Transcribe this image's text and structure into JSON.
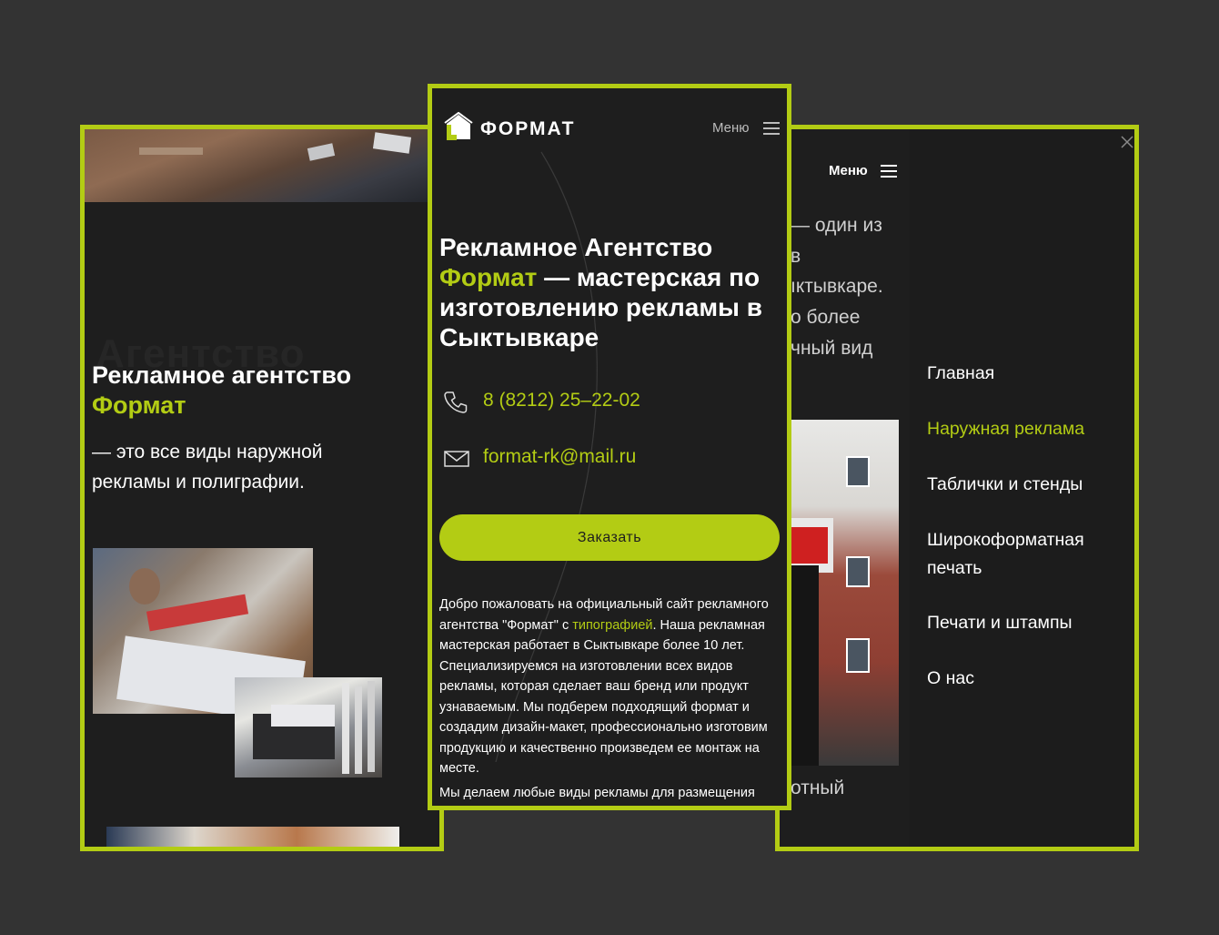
{
  "left_screen": {
    "ghost_word": "Агентство",
    "title_line1": "Рекламное агентство",
    "title_accent": "Формат",
    "subtitle": "— это все виды наружной рекламы и полиграфии."
  },
  "center_screen": {
    "logo_text": "ФОРМАТ",
    "menu_label": "Меню",
    "hero": {
      "part1": "Рекламное Агентство",
      "accent": "Формат",
      "part2": " — мастерская по изготовлению рекламы в Сыктывкаре"
    },
    "phone": "8 (8212) 25–22-02",
    "email": "format-rk@mail.ru",
    "order_button": "Заказать",
    "intro": {
      "before_link": "Добро пожаловать на официальный сайт рекламного агентства \"Формат\" с ",
      "link": "типографией",
      "after_link": ". Наша рекламная мастерская работает в Сыктывкаре более 10 лет. Специализируемся на изготовлении всех видов рекламы, которая сделает ваш бренд или продукт узнаваемым. Мы подберем подходящий формат и создадим дизайн-макет, профессионально изготовим продукцию и качественно произведем ее монтаж на месте.",
      "cut_line": "Мы делаем любые виды рекламы для размещения"
    }
  },
  "right_screen": {
    "menu_label": "Меню",
    "bg_text": [
      "— один из",
      "в",
      "ıктывкаре.",
      "о более",
      "чный вид",
      "отный"
    ],
    "nav": [
      {
        "label": "Главная",
        "active": false
      },
      {
        "label": "Наружная реклама",
        "active": true
      },
      {
        "label": "Таблички и стенды",
        "active": false
      },
      {
        "label": "Широкоформатная печать",
        "active": false
      },
      {
        "label": "Печати и штампы",
        "active": false
      },
      {
        "label": "О нас",
        "active": false
      }
    ]
  },
  "colors": {
    "accent": "#b3cc14",
    "background": "#333333",
    "screen_bg": "#1e1e1e"
  }
}
